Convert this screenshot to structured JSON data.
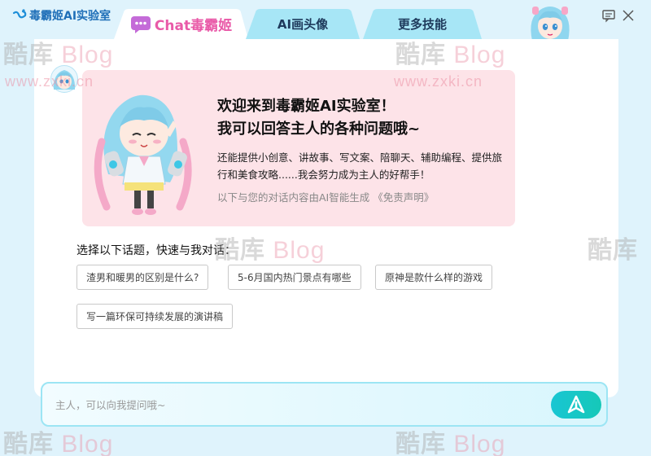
{
  "app": {
    "title": "毒霸姬AI实验室",
    "logo_icon": "swirl-logo-icon"
  },
  "tabs": [
    {
      "label": "Chat毒霸姬",
      "active": true,
      "icon": "chat-bubble-icon"
    },
    {
      "label": "AI画头像",
      "active": false
    },
    {
      "label": "更多技能",
      "active": false
    }
  ],
  "window_controls": {
    "icons": [
      "feedback-icon",
      "close-icon"
    ]
  },
  "welcome": {
    "title_line1": "欢迎来到毒霸姬AI实验室！",
    "title_line2": "我可以回答主人的各种问题哦~",
    "description": "还能提供小创意、讲故事、写文案、陪聊天、辅助编程、提供旅行和美食攻略......我会努力成为主人的好帮手！",
    "disclaimer": "以下与您的对话内容由AI智能生成  《免责声明》"
  },
  "topics": {
    "heading": "选择以下话题，快速与我对话：",
    "items": [
      "渣男和暖男的区别是什么?",
      "5-6月国内热门景点有哪些",
      "原神是款什么样的游戏",
      "写一篇环保可持续发展的演讲稿"
    ]
  },
  "input": {
    "placeholder": "主人，可以向我提问哦~",
    "send_icon": "send-icon"
  },
  "watermark": {
    "brand_prefix": "酷库",
    "brand_suffix": "Blog",
    "url": "www.zxki.cn"
  },
  "colors": {
    "accent": "#17c6c8",
    "chat_tab": "#e95aa8",
    "welcome_bg": "#fde3e8",
    "page_bg": "#dff3fc"
  }
}
